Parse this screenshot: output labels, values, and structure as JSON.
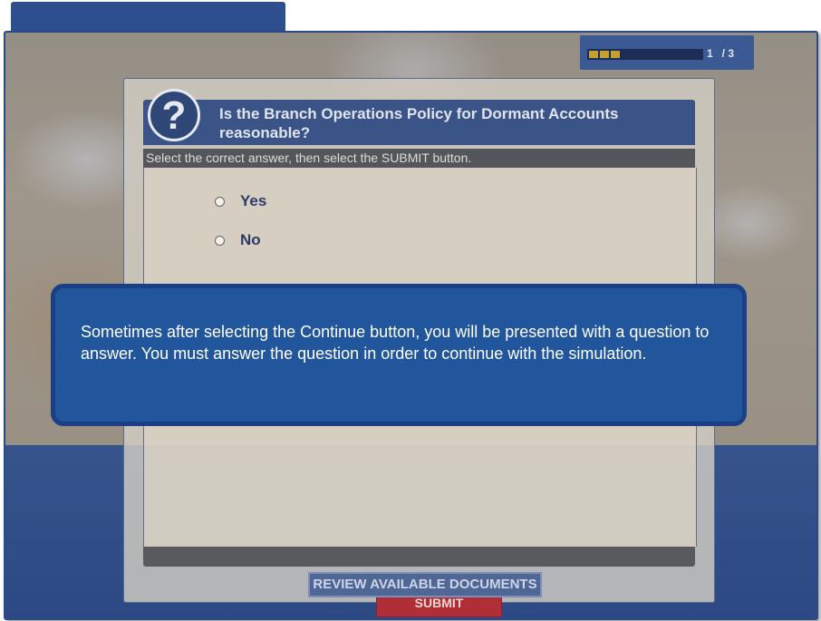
{
  "progress": {
    "current": "1",
    "total": "/ 3",
    "text": "1   / 3",
    "filled_segments": 3
  },
  "question": {
    "icon": "question-mark-icon",
    "glyph": "?",
    "title": "Is the Branch Operations Policy for Dormant Accounts reasonable?",
    "instruction": "Select the correct answer, then select the SUBMIT button.",
    "options": [
      {
        "label": "Yes",
        "selected": false
      },
      {
        "label": "No",
        "selected": false
      }
    ]
  },
  "buttons": {
    "submit": "SUBMIT",
    "review": "REVIEW AVAILABLE DOCUMENTS"
  },
  "callout": {
    "text": "Sometimes after selecting the Continue button, you will be presented with a question to answer. You must answer the question in order to continue with the simulation."
  },
  "colors": {
    "frame": "#2a4a88",
    "header": "#3b5487",
    "submit": "#b02e35",
    "callout": "#22569c",
    "progress_fill": "#c4a030"
  }
}
